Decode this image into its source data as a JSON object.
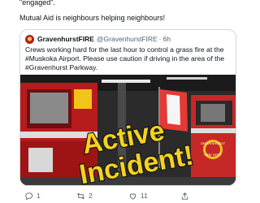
{
  "tweet": {
    "prev_line": "\"engaged\".",
    "text": "Mutual Aid is neighbours helping neighbours!"
  },
  "quote": {
    "name": "GravenhurstFIRE",
    "handle": "@GravenhurstFIRE",
    "dot": "·",
    "time": "6h",
    "lines": [
      "Crews working hard for the last hour to control a grass fire at the",
      "#Muskoka Airport. Please use caution if driving in the area of the",
      "#Gravenhurst Parkway."
    ],
    "image": {
      "overlay_line1": "Active",
      "overlay_line2": "Incident!",
      "truck_text_line1": "GRAVENHURST",
      "truck_text_line2": "FIRE DEPT"
    }
  },
  "actions": {
    "reply_count": "1",
    "retweet_count": "2",
    "like_count": "11"
  },
  "colors": {
    "text": "#0f1419",
    "muted": "#536471",
    "border": "#cfd9de",
    "truck_red": "#c62828",
    "overlay_yellow": "#f4d21f"
  },
  "icons": [
    "reply-icon",
    "retweet-icon",
    "like-icon",
    "share-icon"
  ]
}
